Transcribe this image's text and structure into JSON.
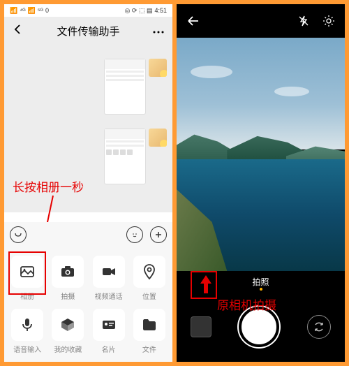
{
  "status": {
    "signal1": "⁴ᴳ",
    "signal2": "⁵ᴳ",
    "wifi": "0",
    "icons": "◎ ⟳ ⬚ ▤",
    "time": "4:51"
  },
  "left": {
    "title": "文件传输助手",
    "annotation": "长按相册一秒",
    "grid": [
      {
        "label": "相册",
        "icon": "image"
      },
      {
        "label": "拍摄",
        "icon": "camera"
      },
      {
        "label": "视频通话",
        "icon": "video"
      },
      {
        "label": "位置",
        "icon": "pin"
      },
      {
        "label": "语音输入",
        "icon": "mic"
      },
      {
        "label": "我的收藏",
        "icon": "box"
      },
      {
        "label": "名片",
        "icon": "card"
      },
      {
        "label": "文件",
        "icon": "folder"
      }
    ]
  },
  "right": {
    "mode": "拍照",
    "annotation": "原相机拍摄"
  }
}
